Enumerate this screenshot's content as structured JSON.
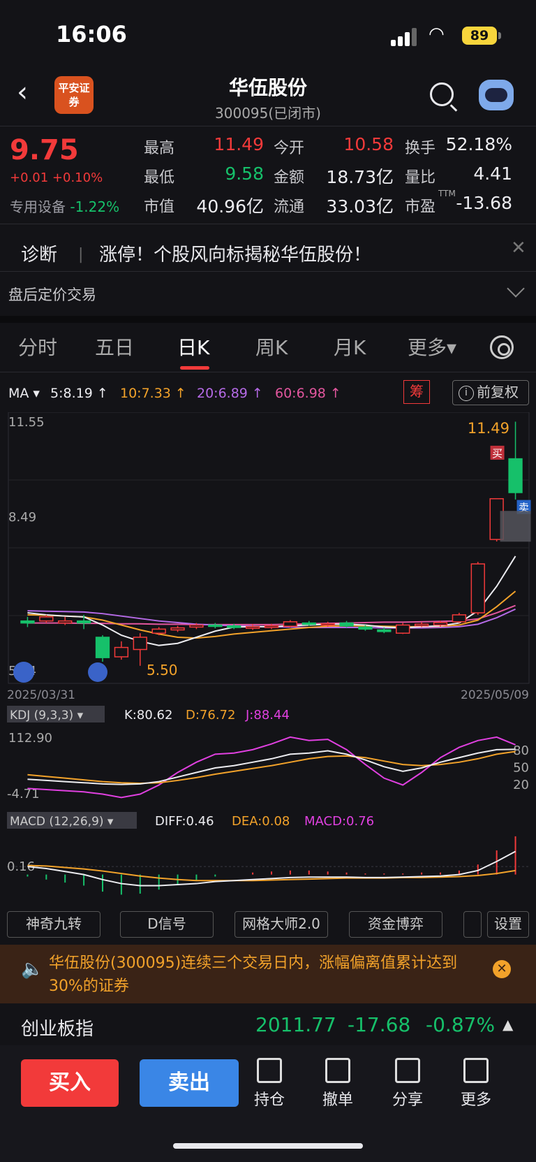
{
  "status": {
    "time": "16:06",
    "battery": "89"
  },
  "header": {
    "title": "华伍股份",
    "subtitle": "300095(已闭市)",
    "logo": "平安证券"
  },
  "quote": {
    "price": "9.75",
    "change": "+0.01",
    "pct": "+0.10%",
    "sector": "专用设备",
    "sector_pct": "-1.22%",
    "fields": [
      {
        "label": "最高",
        "value": "11.49",
        "color": "#f23a3a"
      },
      {
        "label": "今开",
        "value": "10.58",
        "color": "#f23a3a"
      },
      {
        "label": "换手",
        "value": "52.18%",
        "color": "#ececf0"
      },
      {
        "label": "最低",
        "value": "9.58",
        "color": "#16c06a"
      },
      {
        "label": "金额",
        "value": "18.73亿",
        "color": "#ececf0"
      },
      {
        "label": "量比",
        "value": "4.41",
        "color": "#ececf0"
      },
      {
        "label": "市值",
        "value": "40.96亿",
        "color": "#ececf0"
      },
      {
        "label": "流通",
        "value": "33.03亿",
        "color": "#ececf0"
      },
      {
        "label": "市盈",
        "value": "-13.68",
        "color": "#ececf0",
        "sup": "TTM"
      }
    ]
  },
  "diagnosis": {
    "label": "诊断",
    "sep": "|",
    "message": "涨停！个股风向标揭秘华伍股份！"
  },
  "after_hours": "盘后定价交易",
  "tabs": [
    "分时",
    "五日",
    "日K",
    "周K",
    "月K",
    "更多▾"
  ],
  "kline": {
    "ma_title": "MA ▾",
    "ma": [
      {
        "text": "5:8.19 ↑",
        "color": "#ececf0"
      },
      {
        "text": "10:7.33 ↑",
        "color": "#f2a22a"
      },
      {
        "text": "20:6.89 ↑",
        "color": "#b56ae6"
      },
      {
        "text": "60:6.98 ↑",
        "color": "#e2569e"
      }
    ],
    "chip_label": "筹",
    "adjust_label": "前复权",
    "y_top": "11.55",
    "y_mid": "8.49",
    "y_bot": "5.24",
    "date_start": "2025/03/31",
    "date_end": "2025/05/09",
    "high_label": "11.49",
    "low_label": "5.50",
    "buy_mark": "买",
    "sell_mark": "卖"
  },
  "kdj": {
    "title": "KDJ (9,3,3) ▾",
    "k": "K:80.62",
    "d": "D:76.72",
    "j": "J:88.44",
    "y_top": "112.90",
    "y_bot": "-4.71",
    "levels": [
      "80",
      "50",
      "20"
    ]
  },
  "macd": {
    "title": "MACD (12,26,9) ▾",
    "diff": "DIFF:0.46",
    "dea": "DEA:0.08",
    "macd": "MACD:0.76",
    "y": "0.16"
  },
  "buttons": [
    "神奇九转",
    "D信号",
    "网格大师2.0",
    "资金博弈",
    "设置"
  ],
  "notice": "华伍股份(300095)连续三个交易日内，涨幅偏离值累计达到30%的证券",
  "index": {
    "name": "创业板指",
    "value": "2011.77",
    "change": "-17.68",
    "pct": "-0.87%"
  },
  "actions": {
    "buy": "买入",
    "sell": "卖出",
    "items": [
      "持仓",
      "撤单",
      "分享",
      "更多"
    ]
  },
  "chart_data": {
    "type": "candlestick",
    "x_range": [
      "2025/03/31",
      "2025/05/09"
    ],
    "ylim": [
      5.24,
      11.55
    ],
    "candles": [
      {
        "o": 6.6,
        "c": 6.55,
        "h": 6.7,
        "l": 6.45
      },
      {
        "o": 6.6,
        "c": 6.7,
        "h": 6.75,
        "l": 6.55
      },
      {
        "o": 6.55,
        "c": 6.6,
        "h": 6.7,
        "l": 6.5
      },
      {
        "o": 6.6,
        "c": 6.55,
        "h": 6.75,
        "l": 6.4
      },
      {
        "o": 6.2,
        "c": 5.7,
        "h": 6.25,
        "l": 5.6
      },
      {
        "o": 5.72,
        "c": 5.95,
        "h": 6.1,
        "l": 5.65
      },
      {
        "o": 5.9,
        "c": 6.2,
        "h": 6.3,
        "l": 5.5
      },
      {
        "o": 6.3,
        "c": 6.4,
        "h": 6.45,
        "l": 6.25
      },
      {
        "o": 6.38,
        "c": 6.43,
        "h": 6.48,
        "l": 6.33
      },
      {
        "o": 6.45,
        "c": 6.5,
        "h": 6.55,
        "l": 6.4
      },
      {
        "o": 6.5,
        "c": 6.47,
        "h": 6.55,
        "l": 6.42
      },
      {
        "o": 6.48,
        "c": 6.44,
        "h": 6.53,
        "l": 6.4
      },
      {
        "o": 6.42,
        "c": 6.46,
        "h": 6.52,
        "l": 6.38
      },
      {
        "o": 6.44,
        "c": 6.48,
        "h": 6.53,
        "l": 6.4
      },
      {
        "o": 6.47,
        "c": 6.58,
        "h": 6.62,
        "l": 6.44
      },
      {
        "o": 6.55,
        "c": 6.52,
        "h": 6.6,
        "l": 6.48
      },
      {
        "o": 6.5,
        "c": 6.53,
        "h": 6.58,
        "l": 6.46
      },
      {
        "o": 6.55,
        "c": 6.48,
        "h": 6.6,
        "l": 6.44
      },
      {
        "o": 6.45,
        "c": 6.4,
        "h": 6.5,
        "l": 6.36
      },
      {
        "o": 6.38,
        "c": 6.34,
        "h": 6.44,
        "l": 6.3
      },
      {
        "o": 6.3,
        "c": 6.5,
        "h": 6.55,
        "l": 6.28
      },
      {
        "o": 6.48,
        "c": 6.52,
        "h": 6.57,
        "l": 6.45
      },
      {
        "o": 6.5,
        "c": 6.56,
        "h": 6.6,
        "l": 6.46
      },
      {
        "o": 6.58,
        "c": 6.75,
        "h": 6.8,
        "l": 6.55
      },
      {
        "o": 6.8,
        "c": 8.0,
        "h": 8.05,
        "l": 6.75
      },
      {
        "o": 8.6,
        "c": 9.6,
        "h": 9.6,
        "l": 8.55
      },
      {
        "o": 10.58,
        "c": 9.75,
        "h": 11.49,
        "l": 9.58
      }
    ],
    "ma5": [
      6.8,
      6.75,
      6.72,
      6.7,
      6.5,
      6.25,
      6.1,
      6.0,
      6.05,
      6.2,
      6.35,
      6.45,
      6.46,
      6.46,
      6.48,
      6.5,
      6.52,
      6.52,
      6.5,
      6.45,
      6.43,
      6.46,
      6.48,
      6.55,
      6.85,
      7.45,
      8.19
    ],
    "ma10": [
      6.75,
      6.74,
      6.72,
      6.7,
      6.62,
      6.5,
      6.38,
      6.28,
      6.2,
      6.18,
      6.22,
      6.28,
      6.32,
      6.36,
      6.4,
      6.44,
      6.47,
      6.48,
      6.48,
      6.47,
      6.46,
      6.46,
      6.47,
      6.5,
      6.62,
      6.95,
      7.33
    ],
    "ma20": [
      6.85,
      6.84,
      6.83,
      6.82,
      6.78,
      6.72,
      6.66,
      6.6,
      6.56,
      6.52,
      6.5,
      6.48,
      6.47,
      6.46,
      6.45,
      6.44,
      6.44,
      6.44,
      6.44,
      6.43,
      6.43,
      6.43,
      6.44,
      6.46,
      6.52,
      6.68,
      6.89
    ],
    "ma60": [
      6.55,
      6.55,
      6.55,
      6.54,
      6.54,
      6.53,
      6.53,
      6.52,
      6.52,
      6.51,
      6.51,
      6.51,
      6.51,
      6.51,
      6.52,
      6.53,
      6.54,
      6.55,
      6.56,
      6.57,
      6.57,
      6.58,
      6.59,
      6.6,
      6.65,
      6.8,
      6.98
    ],
    "kdj": {
      "ylim": [
        -4.71,
        112.9
      ],
      "K": [
        28,
        26,
        24,
        22,
        20,
        19,
        20,
        24,
        32,
        40,
        48,
        52,
        58,
        64,
        72,
        74,
        78,
        72,
        62,
        50,
        42,
        48,
        58,
        66,
        74,
        80,
        80.62
      ],
      "D": [
        36,
        33,
        30,
        27,
        24,
        22,
        21,
        22,
        26,
        31,
        37,
        42,
        47,
        52,
        58,
        64,
        68,
        69,
        66,
        60,
        54,
        52,
        54,
        58,
        64,
        72,
        76.72
      ],
      "J": [
        12,
        10,
        8,
        6,
        2,
        -4,
        2,
        18,
        40,
        58,
        72,
        74,
        80,
        90,
        102,
        96,
        98,
        80,
        54,
        30,
        18,
        40,
        66,
        84,
        96,
        102,
        88.44
      ]
    },
    "macd": {
      "DIFF": [
        0.16,
        0.12,
        0.06,
        0.0,
        -0.1,
        -0.18,
        -0.22,
        -0.22,
        -0.2,
        -0.18,
        -0.14,
        -0.12,
        -0.1,
        -0.08,
        -0.06,
        -0.05,
        -0.05,
        -0.05,
        -0.06,
        -0.06,
        -0.05,
        -0.04,
        -0.03,
        0.0,
        0.08,
        0.26,
        0.46
      ],
      "DEA": [
        0.18,
        0.17,
        0.14,
        0.11,
        0.07,
        0.02,
        -0.03,
        -0.07,
        -0.1,
        -0.12,
        -0.12,
        -0.12,
        -0.12,
        -0.11,
        -0.1,
        -0.09,
        -0.08,
        -0.07,
        -0.07,
        -0.07,
        -0.06,
        -0.06,
        -0.05,
        -0.04,
        -0.02,
        0.02,
        0.08
      ],
      "MACD": [
        -0.04,
        -0.1,
        -0.16,
        -0.22,
        -0.34,
        -0.4,
        -0.38,
        -0.3,
        -0.2,
        -0.12,
        -0.04,
        0.0,
        0.04,
        0.06,
        0.08,
        0.08,
        0.06,
        0.04,
        0.02,
        0.02,
        0.02,
        0.04,
        0.04,
        0.08,
        0.2,
        0.48,
        0.76
      ]
    }
  }
}
